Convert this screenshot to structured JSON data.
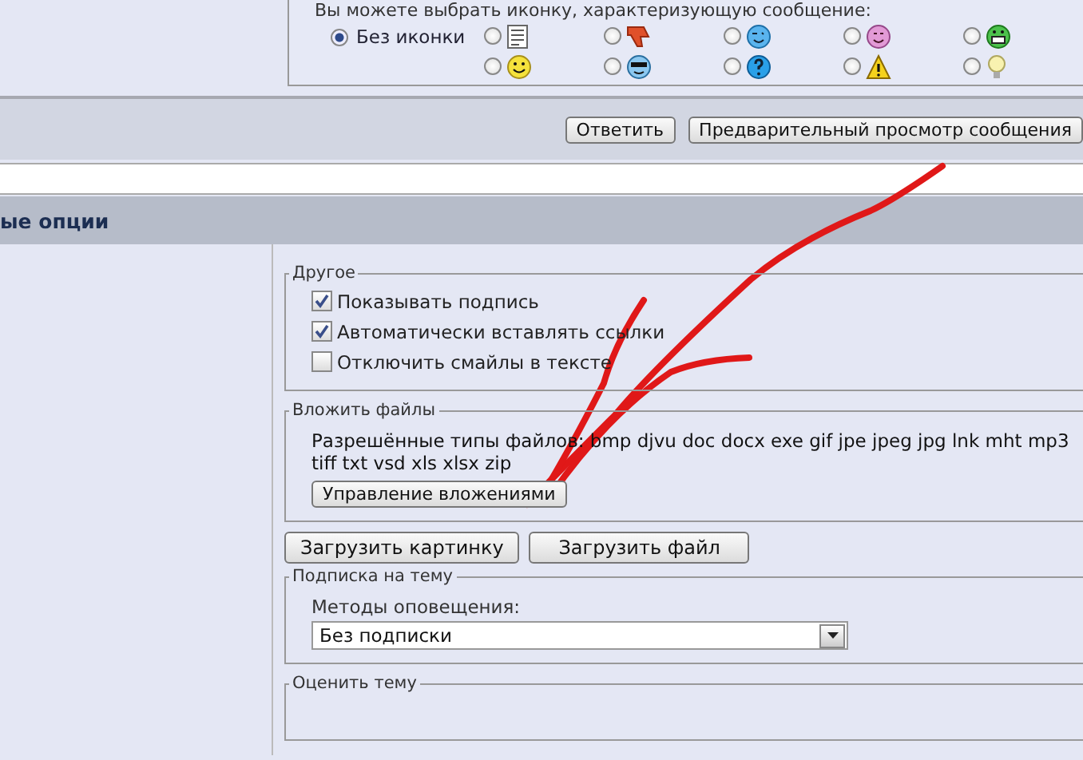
{
  "icon_picker": {
    "hint": "Вы можете выбрать иконку, характеризующую сообщение:",
    "no_icon": {
      "label": "Без иконки",
      "selected": true
    },
    "icons": [
      {
        "kind": "document",
        "selected": false
      },
      {
        "kind": "thumb-down",
        "selected": false
      },
      {
        "kind": "wink",
        "selected": false
      },
      {
        "kind": "purple-smile",
        "selected": false
      },
      {
        "kind": "grin",
        "selected": false
      },
      {
        "kind": "smile",
        "selected": false
      },
      {
        "kind": "sunglasses",
        "selected": false
      },
      {
        "kind": "question",
        "selected": false
      },
      {
        "kind": "warning",
        "selected": false
      },
      {
        "kind": "lightbulb",
        "selected": false
      }
    ]
  },
  "actions": [
    "Ответить",
    "Предварительный просмотр сообщения"
  ],
  "section_title": "ые опции",
  "other": {
    "legend": "Другое",
    "options": [
      {
        "label": "Показывать подпись",
        "checked": true
      },
      {
        "label": "Автоматически вставлять ссылки",
        "checked": true
      },
      {
        "label": "Отключить смайлы в тексте",
        "checked": false
      }
    ]
  },
  "attachments": {
    "legend": "Вложить файлы",
    "allowed_lines": [
      "Разрешённые типы файлов: bmp djvu doc docx exe gif jpe jpeg jpg lnk mht mp3",
      "tiff txt vsd xls xlsx zip"
    ],
    "manage_button": "Управление вложениями"
  },
  "upload_buttons": [
    "Загрузить картинку",
    "Загрузить файл"
  ],
  "subscription": {
    "legend": "Подписка на тему",
    "label": "Методы оповещения:",
    "value": "Без подписки"
  },
  "rating": {
    "legend": "Оценить тему"
  }
}
